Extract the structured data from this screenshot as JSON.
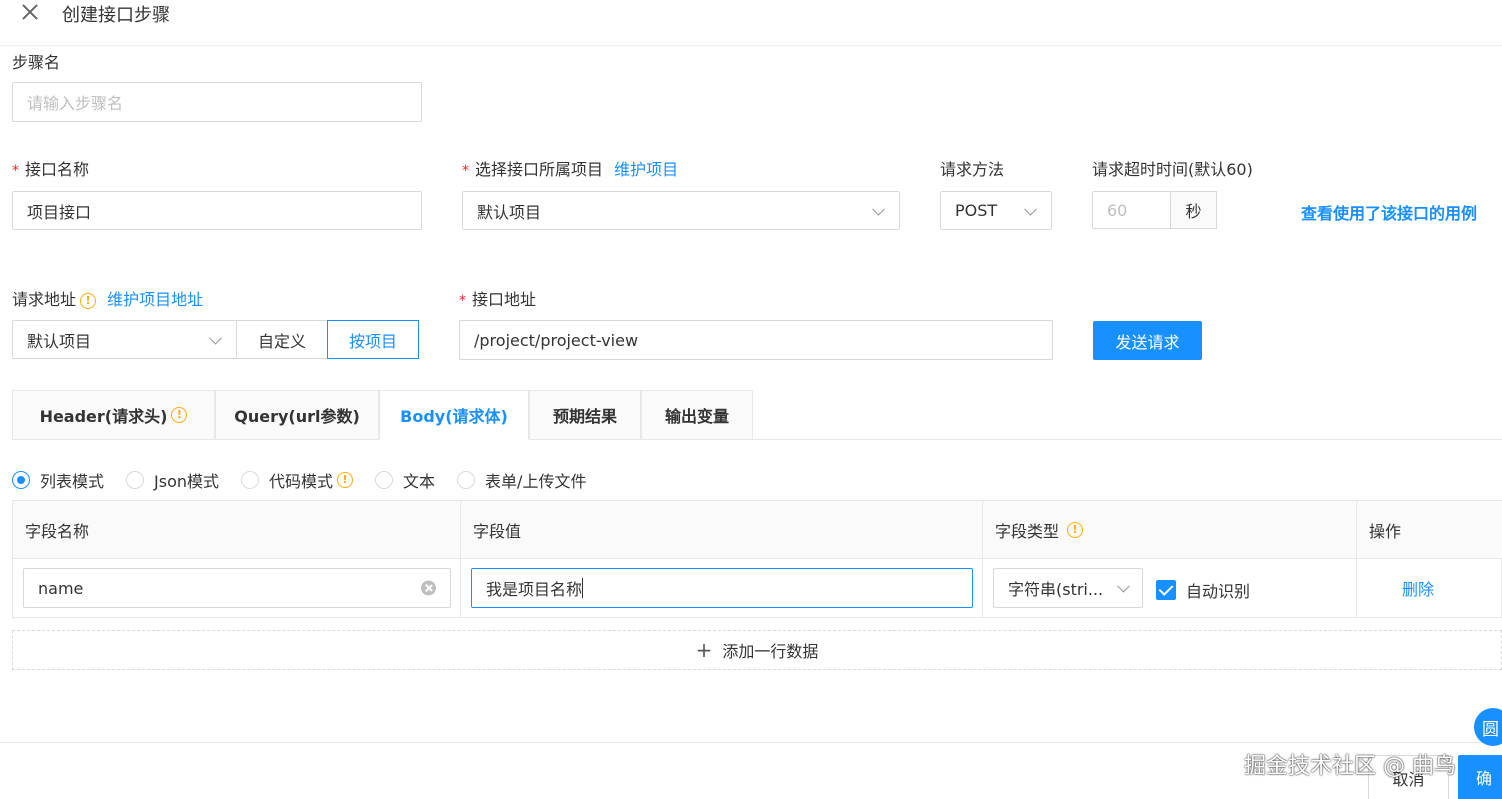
{
  "header": {
    "title": "创建接口步骤"
  },
  "step_name": {
    "label": "步骤名",
    "placeholder": "请输入步骤名"
  },
  "api_name": {
    "label": "接口名称",
    "value": "项目接口"
  },
  "project": {
    "label": "选择接口所属项目",
    "link": "维护项目",
    "value": "默认项目"
  },
  "method": {
    "label": "请求方法",
    "value": "POST"
  },
  "timeout": {
    "label": "请求超时时间(默认60)",
    "placeholder": "60",
    "unit": "秒"
  },
  "usage_link": "查看使用了该接口的用例",
  "request_address": {
    "label": "请求地址",
    "link": "维护项目地址",
    "value": "默认项目",
    "custom_label": "自定义",
    "by_project_label": "按项目"
  },
  "api_address": {
    "label": "接口地址",
    "value": "/project/project-view"
  },
  "send_button": "发送请求",
  "tabs": [
    {
      "label": "Header(请求头)"
    },
    {
      "label": "Query(url参数)"
    },
    {
      "label": "Body(请求体)"
    },
    {
      "label": "预期结果"
    },
    {
      "label": "输出变量"
    }
  ],
  "body_modes": [
    {
      "label": "列表模式",
      "checked": true
    },
    {
      "label": "Json模式"
    },
    {
      "label": "代码模式"
    },
    {
      "label": "文本"
    },
    {
      "label": "表单/上传文件"
    }
  ],
  "table": {
    "headers": {
      "name": "字段名称",
      "value": "字段值",
      "type": "字段类型",
      "action": "操作"
    },
    "row": {
      "name": "name",
      "value": "我是项目名称",
      "type": "字符串(stri...",
      "auto_detect": "自动识别",
      "delete": "删除"
    }
  },
  "add_row": "添加一行数据",
  "footer": {
    "cancel": "取消",
    "confirm": "确",
    "help_glyph": "圆"
  },
  "watermark": "掘金技术社区 @ 曲鸟",
  "colors": {
    "primary": "#1890ff",
    "required": "#f5222d",
    "warning": "#faad14"
  }
}
